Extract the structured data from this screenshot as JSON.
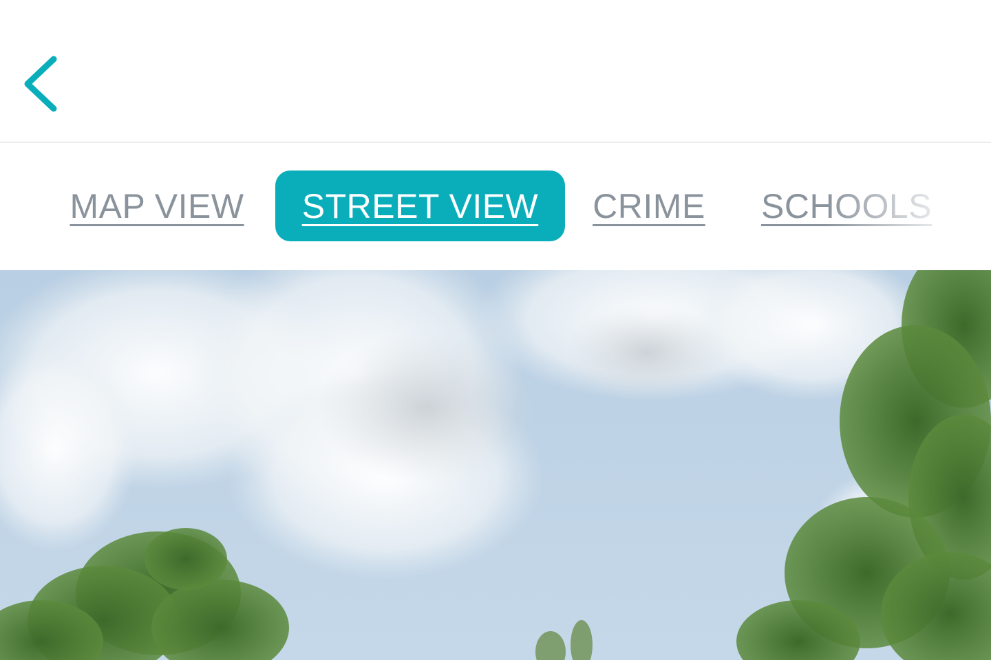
{
  "header": {
    "back_icon": "chevron-left-icon"
  },
  "tabs": [
    {
      "id": "map-view",
      "label": "MAP VIEW",
      "active": false
    },
    {
      "id": "street-view",
      "label": "STREET VIEW",
      "active": true
    },
    {
      "id": "crime",
      "label": "CRIME",
      "active": false
    },
    {
      "id": "schools",
      "label": "SCHOOLS",
      "active": false
    }
  ],
  "colors": {
    "accent": "#0aaebb",
    "inactive_tab_text": "#8a939c",
    "sky": "#a9c6df"
  },
  "street_view": {
    "content": "panorama-image"
  }
}
